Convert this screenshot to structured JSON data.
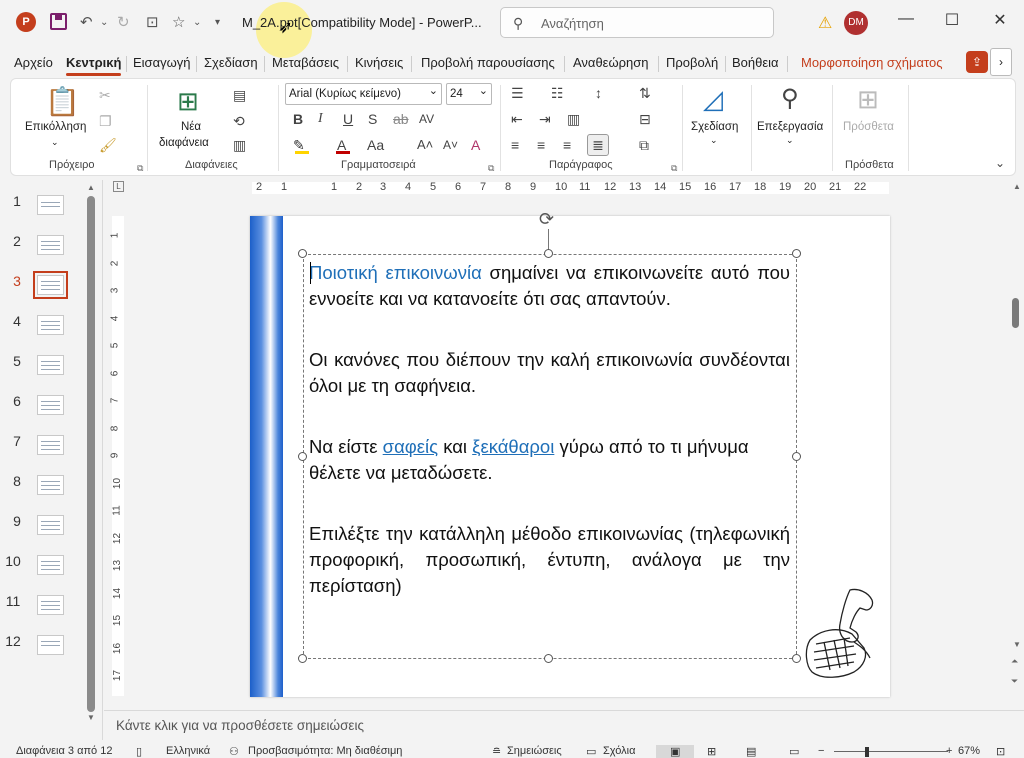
{
  "app": {
    "doc_title": "M_2A.ppt[Compatibility Mode] - PowerP...",
    "search_placeholder": "Αναζήτηση",
    "user_initials": "DM",
    "app_letter": "P"
  },
  "tabs": [
    {
      "label": "Αρχείο"
    },
    {
      "label": "Κεντρική"
    },
    {
      "label": "Εισαγωγή"
    },
    {
      "label": "Σχεδίαση"
    },
    {
      "label": "Μεταβάσεις"
    },
    {
      "label": "Κινήσεις"
    },
    {
      "label": "Προβολή παρουσίασης"
    },
    {
      "label": "Αναθεώρηση"
    },
    {
      "label": "Προβολή"
    },
    {
      "label": "Βοήθεια"
    },
    {
      "label": "Μορφοποίηση σχήματος"
    }
  ],
  "ribbon": {
    "clipboard": {
      "paste": "Επικόλληση",
      "group": "Πρόχειρο"
    },
    "slides": {
      "new_slide_1": "Νέα",
      "new_slide_2": "διαφάνεια",
      "group": "Διαφάνειες"
    },
    "font": {
      "name": "Arial (Κυρίως κείμενο)",
      "size": "24",
      "group": "Γραμματοσειρά"
    },
    "paragraph": {
      "group": "Παράγραφος"
    },
    "drawing": {
      "label": "Σχεδίαση"
    },
    "editing": {
      "label": "Επεξεργασία"
    },
    "addins": {
      "label": "Πρόσθετα",
      "group": "Πρόσθετα"
    }
  },
  "slides_pane": {
    "numbers": [
      "1",
      "2",
      "3",
      "4",
      "5",
      "6",
      "7",
      "8",
      "9",
      "10",
      "11",
      "12"
    ],
    "selected": 3
  },
  "ruler": {
    "h": [
      "2",
      "1",
      "1",
      "2",
      "3",
      "4",
      "5",
      "6",
      "7",
      "8",
      "9",
      "10",
      "11",
      "12",
      "13",
      "14",
      "15",
      "16",
      "17",
      "18",
      "19",
      "20",
      "21",
      "22"
    ],
    "v": [
      "1",
      "2",
      "3",
      "4",
      "5",
      "6",
      "7",
      "8",
      "9",
      "10",
      "11",
      "12",
      "13",
      "14",
      "15",
      "16",
      "17"
    ],
    "tab_selector": "L"
  },
  "slide": {
    "p1_highlight": "Ποιοτική επικοινωνία",
    "p1_rest": " σημαίνει να επικοινωνείτε αυτό που εννοείτε και να κατανοείτε ότι σας απαντούν.",
    "p2": "Οι κανόνες που διέπουν την καλή επικοινωνία συνδέονται όλοι με τη σαφήνεια.",
    "p3_a": "Να είστε ",
    "p3_link1": "σαφείς",
    "p3_b": " και ",
    "p3_link2": "ξεκάθαροι",
    "p3_c": " γύρω από το τι μήνυμα θέλετε να μεταδώσετε.",
    "p4": "Επιλέξτε την κατάλληλη μέθοδο επικοινωνίας (τηλεφωνική προφορική, προσωπική, έντυπη, ανάλογα με την περίσταση)"
  },
  "notes_placeholder": "Κάντε κλικ για να προσθέσετε σημειώσεις",
  "status": {
    "slide_info": "Διαφάνεια 3 από 12",
    "language": "Ελληνικά",
    "accessibility": "Προσβασιμότητα: Μη διαθέσιμη",
    "notes": "Σημειώσεις",
    "comments": "Σχόλια",
    "zoom": "67%"
  },
  "colors": {
    "accent": "#c43e1c",
    "link": "#1f6fb8"
  }
}
